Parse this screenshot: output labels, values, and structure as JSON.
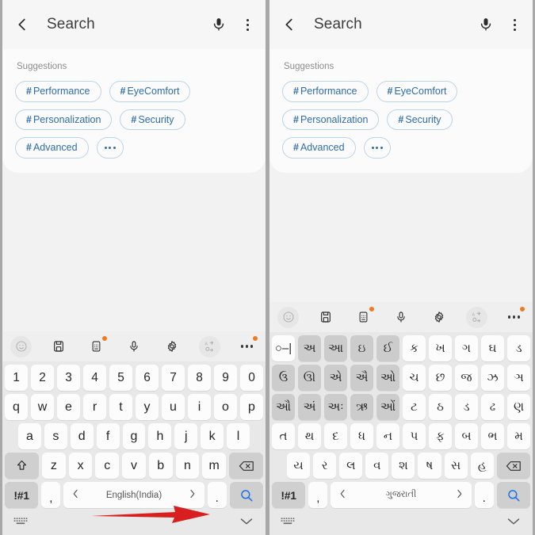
{
  "meta": {
    "accent_blue": "#2f6ca8",
    "chip_border": "#bcd4e8",
    "orange_dot": "#ee7a22",
    "arrow_color": "#d81f1f",
    "key_bg": "#fcfcfc",
    "key_shade_bg": "#cccccc",
    "keyboard_bg": "#e8e8e8",
    "page_bg": "#f2f2f2"
  },
  "header": {
    "title": "Search",
    "back_icon": "back-chevron-icon",
    "mic_icon": "microphone-icon",
    "menu_icon": "more-options-icon"
  },
  "suggestions": {
    "label": "Suggestions",
    "chips": [
      {
        "hash": "#",
        "label": "Performance"
      },
      {
        "hash": "#",
        "label": "EyeComfort"
      },
      {
        "hash": "#",
        "label": "Personalization"
      },
      {
        "hash": "#",
        "label": "Security"
      },
      {
        "hash": "#",
        "label": "Advanced"
      }
    ],
    "more_label": "more-suggestions"
  },
  "keyboard_toolbar": {
    "items": [
      {
        "icon": "emoji-icon",
        "dimmed": true,
        "badge": false
      },
      {
        "icon": "clipboard-icon",
        "dimmed": false,
        "badge": false
      },
      {
        "icon": "keyboard-mode-icon",
        "dimmed": false,
        "badge": true
      },
      {
        "icon": "microphone-icon",
        "dimmed": false,
        "badge": false
      },
      {
        "icon": "settings-gear-icon",
        "dimmed": false,
        "badge": false
      },
      {
        "icon": "translate-icon",
        "dimmed": true,
        "badge": false
      },
      {
        "icon": "more-horizontal-icon",
        "dimmed": false,
        "badge": true
      }
    ]
  },
  "left_panel": {
    "keyboard": {
      "language": "English(India)",
      "rows": [
        [
          "1",
          "2",
          "3",
          "4",
          "5",
          "6",
          "7",
          "8",
          "9",
          "0"
        ],
        [
          "q",
          "w",
          "e",
          "r",
          "t",
          "y",
          "u",
          "i",
          "o",
          "p"
        ],
        [
          "a",
          "s",
          "d",
          "f",
          "g",
          "h",
          "j",
          "k",
          "l"
        ]
      ],
      "row4_letters": [
        "z",
        "x",
        "c",
        "v",
        "b",
        "n",
        "m"
      ],
      "shift_icon": "shift-arrow-icon",
      "backspace_icon": "backspace-icon",
      "symbols_label": "!#1",
      "comma": ",",
      "period": ".",
      "prev_lang_icon": "chevron-left-icon",
      "next_lang_icon": "chevron-right-icon",
      "enter_icon": "search-magnifier-icon"
    }
  },
  "right_panel": {
    "keyboard": {
      "language": "ગુજરાતી",
      "rows": [
        [
          {
            "k": "○–|",
            "shade": false
          },
          {
            "k": "અ",
            "shade": true
          },
          {
            "k": "આ",
            "shade": true
          },
          {
            "k": "ઇ",
            "shade": true
          },
          {
            "k": "ઈ",
            "shade": true
          },
          {
            "k": "ક",
            "shade": false
          },
          {
            "k": "ખ",
            "shade": false
          },
          {
            "k": "ગ",
            "shade": false
          },
          {
            "k": "ઘ",
            "shade": false
          },
          {
            "k": "ડ",
            "shade": false
          }
        ],
        [
          {
            "k": "ઉ",
            "shade": true
          },
          {
            "k": "ઊ",
            "shade": true
          },
          {
            "k": "એ",
            "shade": true
          },
          {
            "k": "ઐ",
            "shade": true
          },
          {
            "k": "ઓ",
            "shade": true
          },
          {
            "k": "ચ",
            "shade": false
          },
          {
            "k": "છ",
            "shade": false
          },
          {
            "k": "જ",
            "shade": false
          },
          {
            "k": "ઝ",
            "shade": false
          },
          {
            "k": "ઞ",
            "shade": false
          }
        ],
        [
          {
            "k": "ઔ",
            "shade": true
          },
          {
            "k": "અં",
            "shade": true
          },
          {
            "k": "અઃ",
            "shade": true
          },
          {
            "k": "ઋ",
            "shade": true
          },
          {
            "k": "ઓં",
            "shade": true
          },
          {
            "k": "ટ",
            "shade": false
          },
          {
            "k": "ઠ",
            "shade": false
          },
          {
            "k": "ડ",
            "shade": false
          },
          {
            "k": "ઢ",
            "shade": false
          },
          {
            "k": "ણ",
            "shade": false
          }
        ],
        [
          {
            "k": "ત",
            "shade": false
          },
          {
            "k": "થ",
            "shade": false
          },
          {
            "k": "દ",
            "shade": false
          },
          {
            "k": "ધ",
            "shade": false
          },
          {
            "k": "ન",
            "shade": false
          },
          {
            "k": "પ",
            "shade": false
          },
          {
            "k": "ફ",
            "shade": false
          },
          {
            "k": "બ",
            "shade": false
          },
          {
            "k": "ભ",
            "shade": false
          },
          {
            "k": "મ",
            "shade": false
          }
        ]
      ],
      "row5_letters": [
        "ય",
        "ર",
        "લ",
        "વ",
        "શ",
        "ષ",
        "સ",
        "હ"
      ],
      "backspace_icon": "backspace-icon",
      "symbols_label": "!#1",
      "comma": ",",
      "period": ".",
      "prev_lang_icon": "chevron-left-icon",
      "next_lang_icon": "chevron-right-icon",
      "enter_icon": "search-magnifier-icon"
    }
  },
  "navbar": {
    "keyboard_icon": "keyboard-toggle-icon",
    "collapse_icon": "chevron-down-icon"
  },
  "annotation": {
    "arrow_icon": "red-arrow-right-annotation"
  }
}
